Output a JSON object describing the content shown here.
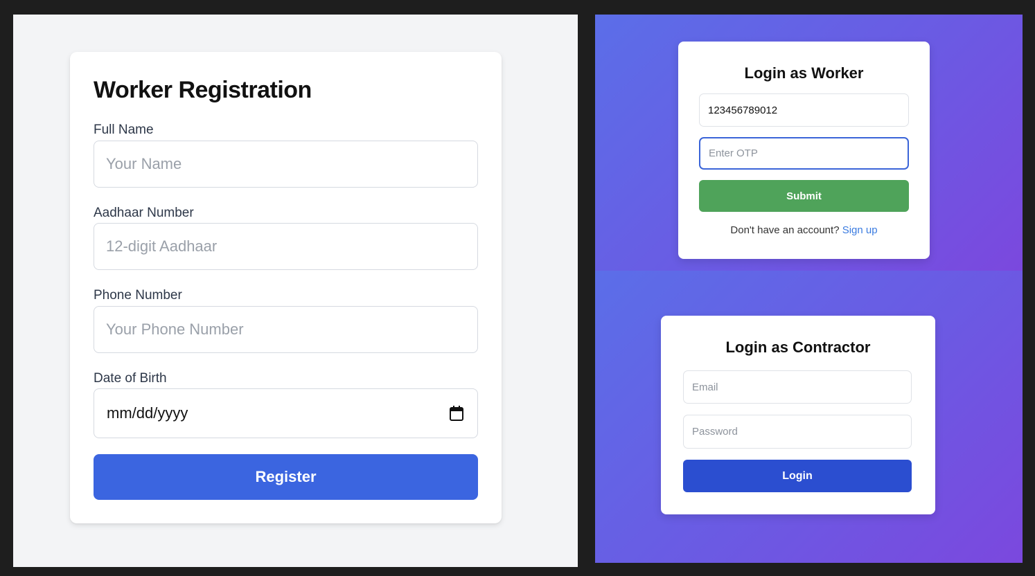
{
  "registration": {
    "title": "Worker Registration",
    "full_name": {
      "label": "Full Name",
      "placeholder": "Your Name"
    },
    "aadhaar": {
      "label": "Aadhaar Number",
      "placeholder": "12-digit Aadhaar"
    },
    "phone": {
      "label": "Phone Number",
      "placeholder": "Your Phone Number"
    },
    "dob": {
      "label": "Date of Birth",
      "value": "mm/dd/yyyy",
      "icon": "calendar-icon"
    },
    "register_label": "Register",
    "accent_color": "#3b65e0"
  },
  "worker_login": {
    "title": "Login as Worker",
    "aadhaar_value": "123456789012",
    "otp_placeholder": "Enter OTP",
    "submit_label": "Submit",
    "signup_prompt": "Don't have an account?",
    "signup_link": "Sign up",
    "submit_color": "#4fa35a"
  },
  "contractor_login": {
    "title": "Login as Contractor",
    "email_placeholder": "Email",
    "password_placeholder": "Password",
    "login_label": "Login",
    "login_color": "#2b4ed0"
  }
}
